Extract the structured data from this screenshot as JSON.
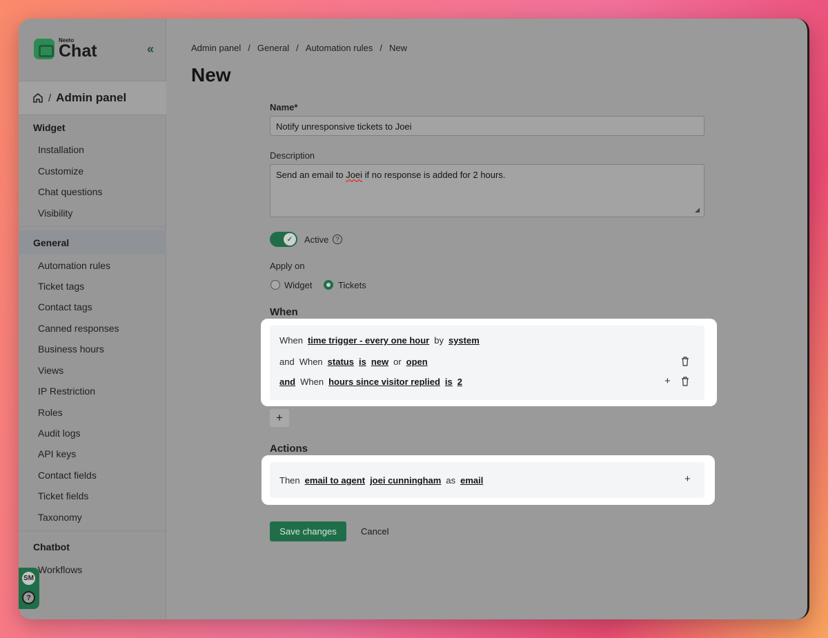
{
  "app": {
    "logo_small": "Neeto",
    "logo_big": "Chat"
  },
  "admin_header": {
    "title": "Admin panel"
  },
  "sidebar": {
    "widget_title": "Widget",
    "widget_items": [
      "Installation",
      "Customize",
      "Chat questions",
      "Visibility"
    ],
    "general_title": "General",
    "general_items": [
      "Automation rules",
      "Ticket tags",
      "Contact tags",
      "Canned responses",
      "Business hours",
      "Views",
      "IP Restriction",
      "Roles",
      "Audit logs",
      "API keys",
      "Contact fields",
      "Ticket fields",
      "Taxonomy"
    ],
    "chatbot_title": "Chatbot",
    "chatbot_items": [
      "Workflows"
    ],
    "avatar_initials": "SM"
  },
  "breadcrumb": [
    "Admin panel",
    "General",
    "Automation rules",
    "New"
  ],
  "page_title": "New",
  "form": {
    "name_label": "Name*",
    "name_value": "Notify unresponsive tickets to Joei",
    "description_label": "Description",
    "description_pre": "Send an email to ",
    "description_name": "Joei",
    "description_post": " if no response is added for 2 hours.",
    "active_label": "Active",
    "apply_on_label": "Apply on",
    "apply_options": [
      "Widget",
      "Tickets"
    ],
    "apply_selected": "Tickets",
    "when_title": "When",
    "actions_title": "Actions",
    "save_label": "Save changes",
    "cancel_label": "Cancel"
  },
  "conditions": {
    "row1": {
      "w1": "When",
      "t1": "time trigger - every one hour",
      "w2": "by",
      "t2": "system"
    },
    "row2": {
      "w0": "and",
      "w1": "When",
      "t1": "status",
      "t2": "is",
      "t3": "new",
      "w2": "or",
      "t4": "open"
    },
    "row3": {
      "t0": "and",
      "w1": "When",
      "t1": "hours since visitor replied",
      "t2": "is",
      "t3": "2"
    }
  },
  "action": {
    "w1": "Then",
    "t1": "email to agent",
    "t2": "joei cunningham",
    "w2": "as",
    "t3": "email"
  },
  "icons": {
    "add": "+",
    "delete": "trash-icon",
    "collapse": "«"
  },
  "colors": {
    "brand": "#1f6e49",
    "backdrop": "#9a9a9a"
  }
}
